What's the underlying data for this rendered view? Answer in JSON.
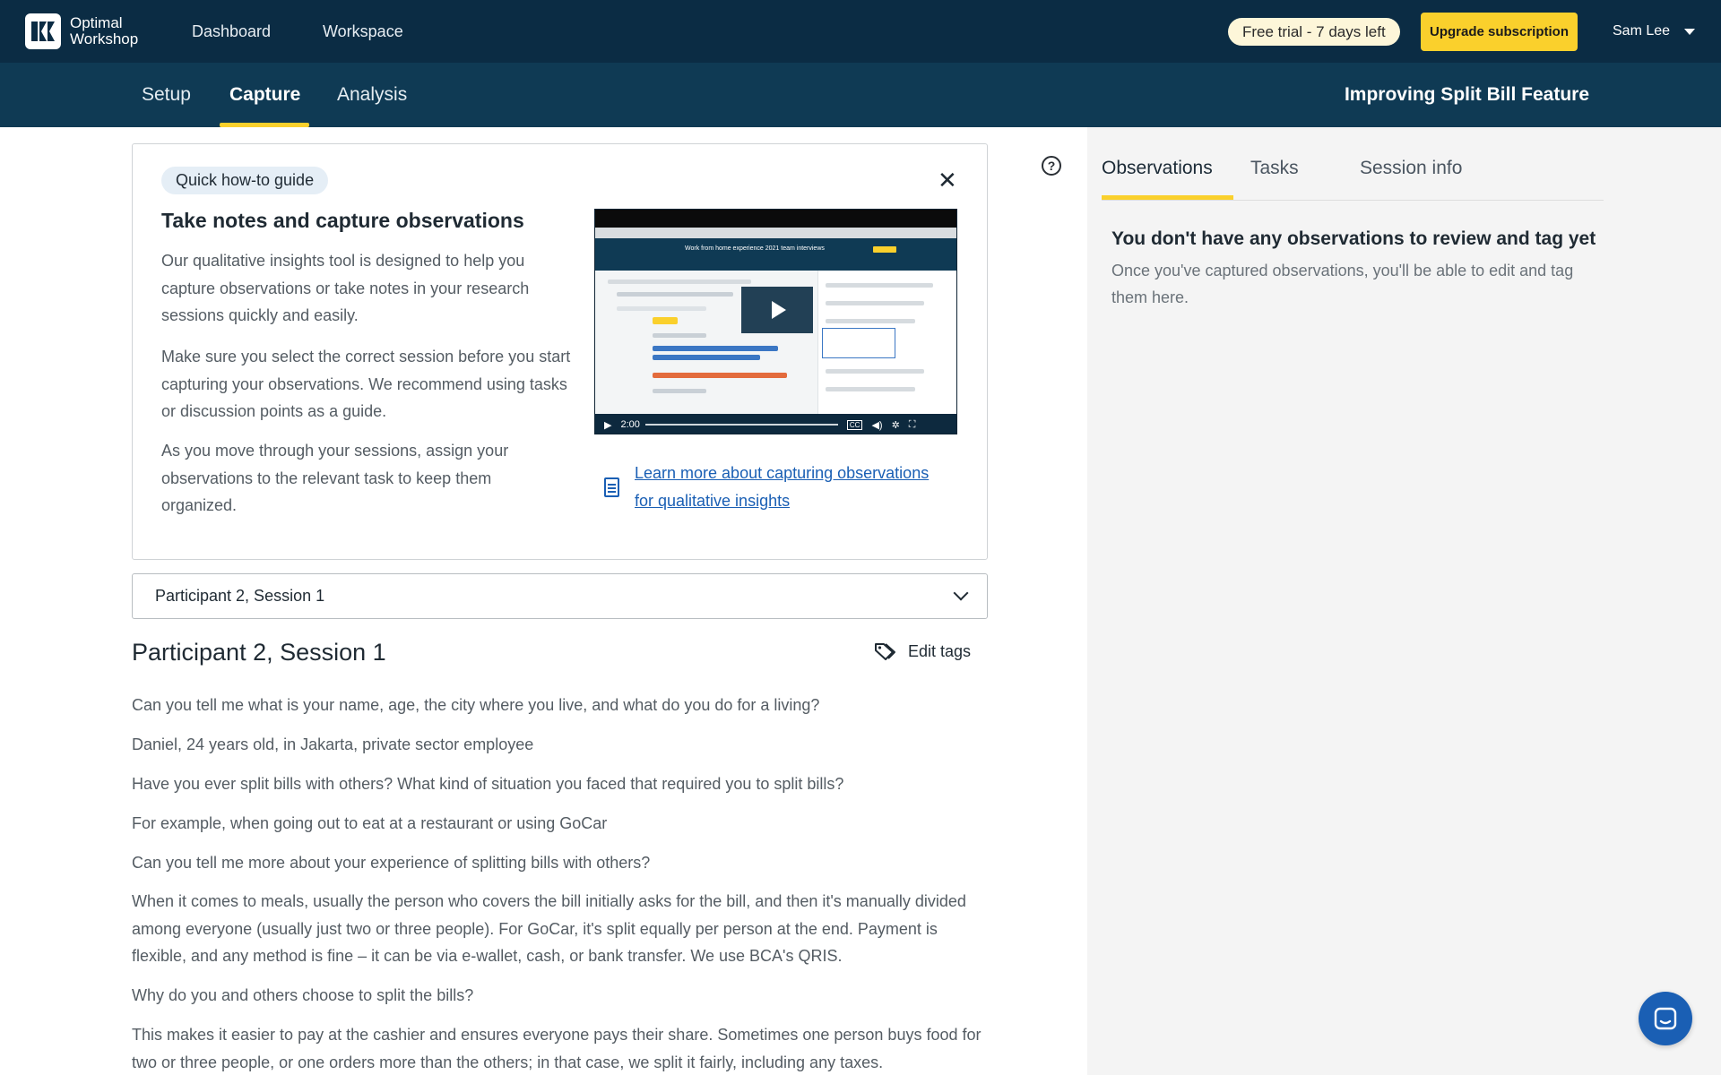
{
  "app": {
    "logo_line1": "Optimal",
    "logo_line2": "Workshop",
    "nav": [
      "Dashboard",
      "Workspace"
    ],
    "trial_badge": "Free trial - 7 days left",
    "upgrade_label": "Upgrade subscription",
    "user_name": "Sam Lee"
  },
  "subnav": {
    "tabs": [
      "Setup",
      "Capture",
      "Analysis"
    ],
    "active_tab": "Capture",
    "study_title": "Improving Split Bill Feature"
  },
  "guide": {
    "pill": "Quick how-to guide",
    "title": "Take notes and capture observations",
    "paragraphs": [
      [
        "Our qualitative insights tool is designed to help you",
        "capture observations or take notes in your research",
        "sessions quickly and easily."
      ],
      [
        "Make sure you select the correct session before you start",
        "capturing your observations. We recommend using tasks",
        "or discussion points as a guide."
      ],
      [
        "As you move through your sessions, assign your",
        "observations to the relevant task to keep them",
        "organized."
      ]
    ],
    "video_time": "2:00",
    "video_header": "Work from home experience 2021 team interviews",
    "video_cc": "CC",
    "learn_line1": "Learn more about capturing observations",
    "learn_line2": "for qualitative insights"
  },
  "session": {
    "selected": "Participant 2, Session 1",
    "heading": "Participant 2, Session 1",
    "edit_tags": "Edit tags",
    "transcript": [
      [
        "Can you tell me what is your name, age, the city where you live, and what do you do for a living?"
      ],
      [
        "Daniel, 24 years old, in Jakarta, private sector employee"
      ],
      [
        "Have you ever split bills with others? What kind of situation you faced that required you to split bills?"
      ],
      [
        "For example, when going out to eat at a restaurant or using GoCar"
      ],
      [
        "Can you tell me more about your experience of splitting bills with others?"
      ],
      [
        "When it comes to meals, usually the person who covers the bill initially asks for the bill, and then it's manually divided",
        "among everyone (usually just two or three people). For GoCar, it's split equally per person at the end. Payment is",
        "flexible, and any method is fine – it can be via e-wallet, cash, or bank transfer. We use BCA's QRIS."
      ],
      [
        "Why do you and others choose to split the bills?"
      ],
      [
        "This makes it easier to pay at the cashier and ensures everyone pays their share. Sometimes one person buys food for",
        "two or three people, or one orders more than the others; in that case, we split it fairly, including any taxes."
      ]
    ]
  },
  "observations": {
    "tabs": [
      "Observations",
      "Tasks",
      "Session info"
    ],
    "active_tab": "Observations",
    "empty_title": "You don't have any observations to review and tag yet",
    "empty_desc_line1": "Once you've captured observations, you'll be able to edit and tag",
    "empty_desc_line2": "them here."
  },
  "colors": {
    "nav_bg": "#0b2c44",
    "subnav_bg": "#0f3a54",
    "accent_yellow": "#fad02c",
    "link_blue": "#1a5fb4"
  },
  "icons": [
    "logo-icon",
    "caret-down-icon",
    "help-icon",
    "close-icon",
    "play-icon",
    "document-icon",
    "chevron-down-icon",
    "tag-icon",
    "chat-icon"
  ]
}
